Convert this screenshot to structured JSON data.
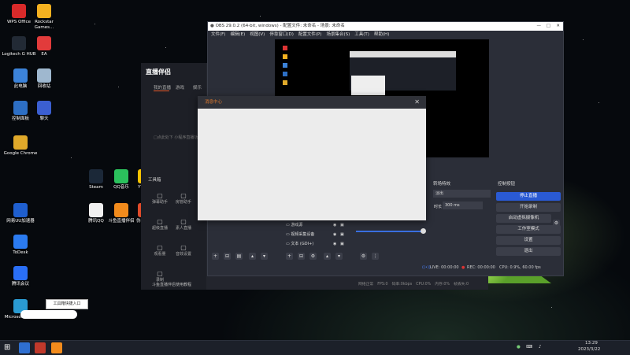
{
  "desktop": {
    "icons": [
      {
        "label": "WPS Office",
        "color": "#d92a2a",
        "x": 0
      },
      {
        "label": "Rockstar Games...",
        "color": "#f4b120",
        "x": 1
      },
      {
        "label": "Logitech G HUB",
        "color": "#222a35",
        "x": 2
      },
      {
        "label": "EA",
        "color": "#e23b3b",
        "x": 3
      },
      {
        "label": "此电脑",
        "color": "#3c83d9",
        "x": 4
      },
      {
        "label": "回收站",
        "color": "#9fb8cf",
        "x": 5
      },
      {
        "label": "控制面板",
        "color": "#2d6fc4",
        "x": 6
      },
      {
        "label": "聊天",
        "color": "#3b5fd1",
        "x": 7
      },
      {
        "label": "Google Chrome",
        "color": "#e0a92a",
        "x": 8
      },
      {
        "label": "Steam",
        "color": "#1b2838",
        "x": 9
      },
      {
        "label": "QQ音乐",
        "color": "#2bc15c",
        "x": 10
      },
      {
        "label": "YY语音",
        "color": "#f5c200",
        "x": 11
      },
      {
        "label": "网易UU加速器",
        "color": "#1f5fcf",
        "x": 12
      },
      {
        "label": "腾讯QQ",
        "color": "#f0f0f0",
        "x": 13
      },
      {
        "label": "斗鱼直播伴侣",
        "color": "#f28b1c",
        "x": 14
      },
      {
        "label": "伪装视频",
        "color": "#e04b2a",
        "x": 15
      },
      {
        "label": "ToDesk",
        "color": "#2b7bf0",
        "x": 16
      },
      {
        "label": "腾讯会议",
        "color": "#2a6ff5",
        "x": 17
      },
      {
        "label": "Microsoft Edge",
        "color": "#2a9ad1",
        "x": 18
      }
    ],
    "tooltip": "工具箱快捷入口"
  },
  "companion": {
    "brand": "直播伴侣",
    "tabs": [
      "我的直播",
      "游戏",
      "娱乐"
    ],
    "hint": "□点此处下 小程序直播功能",
    "sidebar_title": "工具箱",
    "tools": [
      "弹幕助手",
      "房管助手",
      "超级直播",
      "素人直播",
      "观看量",
      "音效设置",
      "录制"
    ],
    "footer": "斗鱼直播伴侣使用教程"
  },
  "obs": {
    "title": "OBS 29.0.2 (64-bit, windows) - 配置文件: 未命名 - 场景: 未命名",
    "menu": [
      "文件(F)",
      "编辑(E)",
      "视图(V)",
      "停靠窗口(D)",
      "配置文件(P)",
      "场景集合(S)",
      "工具(T)",
      "帮助(H)"
    ],
    "docks": {
      "transitions": "转场特效",
      "controls": "控制按钮"
    },
    "transition_value": "淡出",
    "duration_label": "时长",
    "duration_value": "300 ms",
    "sources": [
      "游戏源",
      "视频采集设备",
      "文本 (GDI+)"
    ],
    "controls": [
      "停止直播",
      "开始录制",
      "启动虚拟摄像机",
      "工作室模式",
      "设置",
      "退出"
    ],
    "status": {
      "live": "LIVE: 00:00:00",
      "rec": "REC: 00:00:00",
      "cpu": "CPU: 0.9%, 60.00 fps"
    }
  },
  "companion_status": [
    "网络正常",
    "FPS:0",
    "码率:0kbps",
    "CPU:0%",
    "内存:0%",
    "帧丢失:0"
  ],
  "dialog": {
    "title": "消息中心"
  },
  "taskbar": {
    "time": "13:29",
    "date": "2023/3/22"
  }
}
